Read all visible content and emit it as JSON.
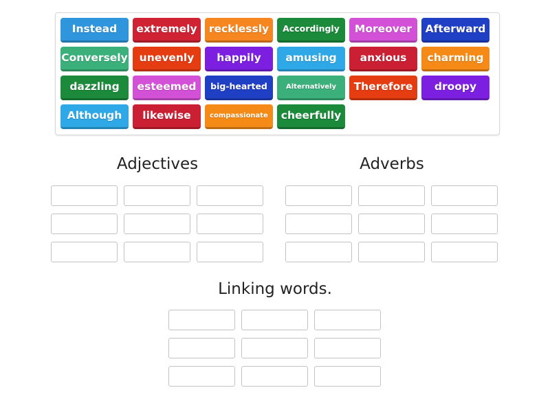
{
  "activity": {
    "type": "group-sort",
    "word_bank": {
      "rows": [
        [
          {
            "label": "Instead",
            "color": "#2f96dd"
          },
          {
            "label": "extremely",
            "color": "#cf2232"
          },
          {
            "label": "recklessly",
            "color": "#f68620"
          },
          {
            "label": "Accordingly",
            "color": "#1b8a3a"
          },
          {
            "label": "Moreover",
            "color": "#d251d6"
          },
          {
            "label": "Afterward",
            "color": "#1f3fc4"
          }
        ],
        [
          {
            "label": "Conversely",
            "color": "#3bb07a"
          },
          {
            "label": "unevenly",
            "color": "#e53c11"
          },
          {
            "label": "happily",
            "color": "#7d1fe0"
          },
          {
            "label": "amusing",
            "color": "#2fa8e8"
          },
          {
            "label": "anxious",
            "color": "#cb1f33"
          },
          {
            "label": "charming",
            "color": "#f58a16"
          }
        ],
        [
          {
            "label": "dazzling",
            "color": "#1b8a3a"
          },
          {
            "label": "esteemed",
            "color": "#d251d6"
          },
          {
            "label": "big-hearted",
            "color": "#1f3fc4"
          },
          {
            "label": "Alternatively",
            "color": "#3bb07a"
          },
          {
            "label": "Therefore",
            "color": "#e53c11"
          },
          {
            "label": "droopy",
            "color": "#7d1fe0"
          }
        ],
        [
          {
            "label": "Although",
            "color": "#2fa8e8"
          },
          {
            "label": "likewise",
            "color": "#cb1f33"
          },
          {
            "label": "compassionate",
            "color": "#f58a16"
          },
          {
            "label": "cheerfully",
            "color": "#1b8a3a"
          }
        ]
      ]
    },
    "categories": [
      {
        "title": "Adjectives",
        "slots": 9
      },
      {
        "title": "Adverbs",
        "slots": 9
      },
      {
        "title": "Linking words.",
        "slots": 9
      }
    ]
  }
}
